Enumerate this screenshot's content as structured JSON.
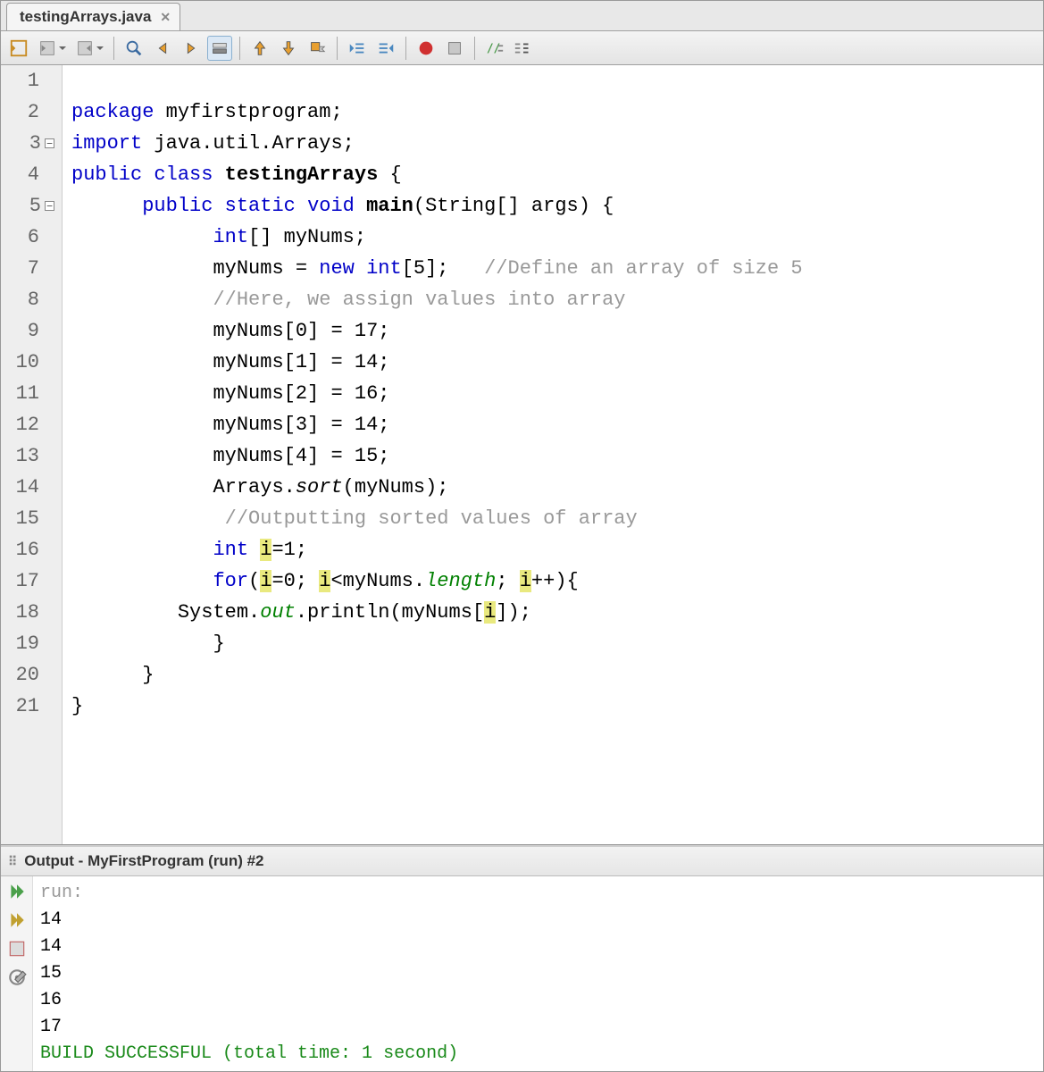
{
  "tab": {
    "filename": "testingArrays.java"
  },
  "toolbar_icons": [
    "source-nav-icon",
    "last-edit-icon",
    "forward-edit-icon",
    "find-icon",
    "prev-icon",
    "next-icon",
    "highlight-icon",
    "shift-up-icon",
    "shift-down-icon",
    "toggle-bookmark-icon",
    "left-indent-icon",
    "right-indent-icon",
    "record-macro-icon",
    "stop-macro-icon",
    "comment-icon",
    "uncomment-icon"
  ],
  "code": {
    "lines": [
      {
        "n": 1,
        "raw": ""
      },
      {
        "n": 2,
        "tokens": [
          [
            "kw",
            "package"
          ],
          [
            "",
            " "
          ],
          [
            "ident",
            "myfirstprogram"
          ],
          [
            "",
            ";"
          ]
        ]
      },
      {
        "n": 3,
        "fold": "-",
        "tokens": [
          [
            "kw",
            "import"
          ],
          [
            "",
            " "
          ],
          [
            "ident",
            "java.util.Arrays"
          ],
          [
            "",
            ";"
          ]
        ]
      },
      {
        "n": 4,
        "tokens": [
          [
            "kw",
            "public"
          ],
          [
            "",
            " "
          ],
          [
            "kw",
            "class"
          ],
          [
            "",
            " "
          ],
          [
            "bold",
            "testingArrays"
          ],
          [
            "",
            " {"
          ]
        ]
      },
      {
        "n": 5,
        "fold": "-",
        "ind": 1,
        "tokens": [
          [
            "kw",
            "public"
          ],
          [
            "",
            " "
          ],
          [
            "kw",
            "static"
          ],
          [
            "",
            " "
          ],
          [
            "kw",
            "void"
          ],
          [
            "",
            " "
          ],
          [
            "bold",
            "main"
          ],
          [
            "",
            "(String[] args) {"
          ]
        ]
      },
      {
        "n": 6,
        "ind": 2,
        "tokens": [
          [
            "kw",
            "int"
          ],
          [
            "",
            "[] myNums;"
          ]
        ]
      },
      {
        "n": 7,
        "ind": 2,
        "tokens": [
          [
            "",
            "myNums = "
          ],
          [
            "kw",
            "new"
          ],
          [
            "",
            " "
          ],
          [
            "kw",
            "int"
          ],
          [
            "",
            "[5];   "
          ],
          [
            "cm",
            "//Define an array of size 5"
          ]
        ]
      },
      {
        "n": 8,
        "ind": 2,
        "tokens": [
          [
            "cm",
            "//Here, we assign values into array"
          ]
        ]
      },
      {
        "n": 9,
        "ind": 2,
        "tokens": [
          [
            "",
            "myNums[0] = 17;"
          ]
        ]
      },
      {
        "n": 10,
        "ind": 2,
        "tokens": [
          [
            "",
            "myNums[1] = 14;"
          ]
        ]
      },
      {
        "n": 11,
        "ind": 2,
        "tokens": [
          [
            "",
            "myNums[2] = 16;"
          ]
        ]
      },
      {
        "n": 12,
        "ind": 2,
        "tokens": [
          [
            "",
            "myNums[3] = 14;"
          ]
        ]
      },
      {
        "n": 13,
        "ind": 2,
        "tokens": [
          [
            "",
            "myNums[4] = 15;"
          ]
        ]
      },
      {
        "n": 14,
        "ind": 2,
        "tokens": [
          [
            "",
            "Arrays."
          ],
          [
            "mtd-it",
            "sort"
          ],
          [
            "",
            "(myNums);"
          ]
        ]
      },
      {
        "n": 15,
        "ind": 2,
        "tokens": [
          [
            "cm",
            " //Outputting sorted values of array"
          ]
        ]
      },
      {
        "n": 16,
        "ind": 2,
        "tokens": [
          [
            "kw",
            "int"
          ],
          [
            "",
            " "
          ],
          [
            "hl",
            "i"
          ],
          [
            "",
            "=1;"
          ]
        ]
      },
      {
        "n": 17,
        "ind": 2,
        "tokens": [
          [
            "kw",
            "for"
          ],
          [
            "",
            "("
          ],
          [
            "hl",
            "i"
          ],
          [
            "",
            "=0; "
          ],
          [
            "hl",
            "i"
          ],
          [
            "",
            "<myNums."
          ],
          [
            "fld",
            "length"
          ],
          [
            "",
            "; "
          ],
          [
            "hl",
            "i"
          ],
          [
            "",
            "++){"
          ]
        ]
      },
      {
        "n": 18,
        "ind": 1.5,
        "tokens": [
          [
            "",
            "System."
          ],
          [
            "fld",
            "out"
          ],
          [
            "",
            ".println(myNums["
          ],
          [
            "hl",
            "i"
          ],
          [
            "",
            "]);"
          ]
        ]
      },
      {
        "n": 19,
        "ind": 2,
        "tokens": [
          [
            "",
            "}"
          ]
        ]
      },
      {
        "n": 20,
        "ind": 1,
        "tokens": [
          [
            "",
            "}"
          ]
        ]
      },
      {
        "n": 21,
        "ind": 0,
        "tokens": [
          [
            "",
            "}"
          ]
        ]
      }
    ]
  },
  "output": {
    "title": "Output - MyFirstProgram (run) #2",
    "lines": [
      {
        "cls": "out-gray",
        "text": "run:"
      },
      {
        "cls": "",
        "text": "14"
      },
      {
        "cls": "",
        "text": "14"
      },
      {
        "cls": "",
        "text": "15"
      },
      {
        "cls": "",
        "text": "16"
      },
      {
        "cls": "",
        "text": "17"
      },
      {
        "cls": "out-green",
        "text": "BUILD SUCCESSFUL (total time: 1 second)"
      }
    ]
  }
}
